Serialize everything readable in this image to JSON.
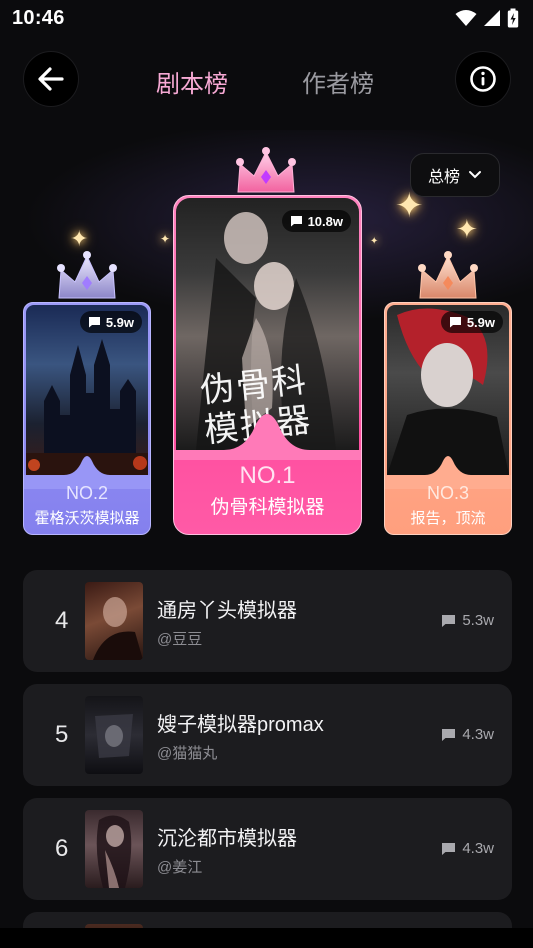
{
  "status_bar": {
    "time": "10:46"
  },
  "header": {
    "tabs": [
      {
        "label": "剧本榜",
        "active": true
      },
      {
        "label": "作者榜",
        "active": false
      }
    ]
  },
  "dropdown": {
    "label": "总榜"
  },
  "podium": [
    {
      "rank_label": "NO.2",
      "title": "霍格沃茨模拟器",
      "count": "5.9w",
      "crown": "silver"
    },
    {
      "rank_label": "NO.1",
      "title": "伪骨科模拟器",
      "count": "10.8w",
      "crown": "pink",
      "cover_title": "伪骨科模拟器"
    },
    {
      "rank_label": "NO.3",
      "title": "报告，顶流",
      "count": "5.9w",
      "crown": "bronze"
    }
  ],
  "list": [
    {
      "rank": "4",
      "title": "通房丫头模拟器",
      "author": "@豆豆",
      "count": "5.3w"
    },
    {
      "rank": "5",
      "title": "嫂子模拟器promax",
      "author": "@猫猫丸",
      "count": "4.3w"
    },
    {
      "rank": "6",
      "title": "沉沦都市模拟器",
      "author": "@姜江",
      "count": "4.3w"
    }
  ],
  "colors": {
    "accent_pink": "#f7a9d4",
    "card_silver": "#8f8cf0",
    "card_gold": "#ff5aa6",
    "card_bronze": "#ffa78a"
  }
}
